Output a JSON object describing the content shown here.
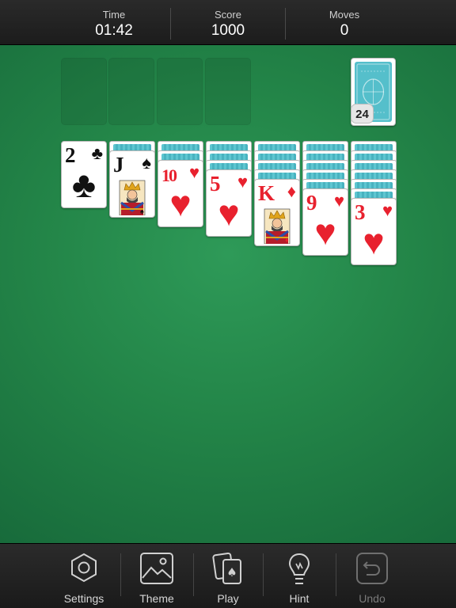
{
  "stats": {
    "time_label": "Time",
    "time_value": "01:42",
    "score_label": "Score",
    "score_value": "1000",
    "moves_label": "Moves",
    "moves_value": "0"
  },
  "stock": {
    "count": "24"
  },
  "tableau": [
    {
      "rank": "2",
      "suit": "♣",
      "color": "black",
      "face_down": 0
    },
    {
      "rank": "J",
      "suit": "♠",
      "color": "black",
      "face_down": 1
    },
    {
      "rank": "10",
      "suit": "♥",
      "color": "red",
      "face_down": 2
    },
    {
      "rank": "5",
      "suit": "♥",
      "color": "red",
      "face_down": 3
    },
    {
      "rank": "K",
      "suit": "♦",
      "color": "red",
      "face_down": 4
    },
    {
      "rank": "9",
      "suit": "♥",
      "color": "red",
      "face_down": 5
    },
    {
      "rank": "3",
      "suit": "♥",
      "color": "red",
      "face_down": 6
    }
  ],
  "toolbar": {
    "settings_label": "Settings",
    "theme_label": "Theme",
    "play_label": "Play",
    "hint_label": "Hint",
    "undo_label": "Undo"
  },
  "colors": {
    "felt": "#238548",
    "card_back": "#55bfcb",
    "red_suit": "#e8212e"
  },
  "icons": [
    "hexagon-settings-icon",
    "picture-theme-icon",
    "cards-play-icon",
    "lightbulb-hint-icon",
    "undo-arrow-icon"
  ]
}
